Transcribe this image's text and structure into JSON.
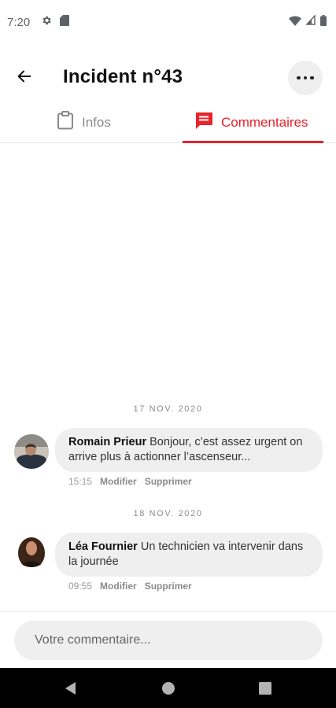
{
  "status_bar": {
    "time": "7:20",
    "left_icons": [
      "settings-icon",
      "sd-card-icon"
    ],
    "right_icons": [
      "wifi-icon",
      "cell-signal-icon",
      "battery-icon"
    ]
  },
  "header": {
    "title": "Incident n°43",
    "back_icon": "arrow-back-icon",
    "more_icon": "more-horizontal-icon"
  },
  "tabs": [
    {
      "label": "Infos",
      "icon": "clipboard-icon",
      "active": false
    },
    {
      "label": "Commentaires",
      "icon": "comment-icon",
      "active": true
    }
  ],
  "accent_color": "#e8232b",
  "comments_thread": [
    {
      "date": "17 NOV. 2020",
      "author": "Romain Prieur",
      "text": "Bonjour, c’est assez urgent on arrive plus à actionner l’ascenseur...",
      "time": "15:15",
      "edit_label": "Modifier",
      "delete_label": "Supprimer"
    },
    {
      "date": "18 NOV. 2020",
      "author": "Léa Fournier",
      "text": "Un technicien va intervenir dans la journée",
      "time": "09:55",
      "edit_label": "Modifier",
      "delete_label": "Supprimer"
    }
  ],
  "composer": {
    "placeholder": "Votre commentaire..."
  },
  "nav_bar": {
    "icons": [
      "nav-back-icon",
      "nav-home-icon",
      "nav-recents-icon"
    ]
  }
}
